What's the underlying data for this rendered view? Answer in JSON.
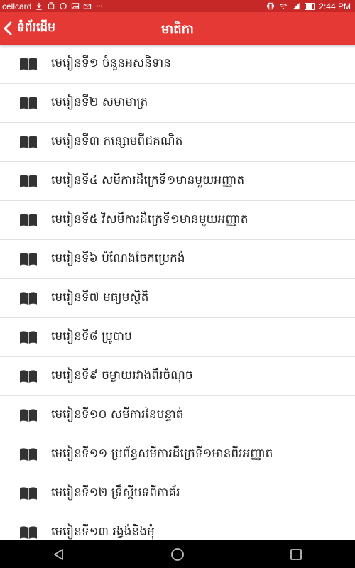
{
  "status_bar": {
    "carrier": "cellcard",
    "time": "2:44 PM"
  },
  "app_bar": {
    "back_label": "ទំព័រដើម",
    "title": "មាតិកា"
  },
  "lessons": [
    "មេរៀនទី១ ចំនួនអសនិទាន",
    "មេរៀនទី២ សមាមាត្រ",
    "មេរៀនទី៣ កន្សោមពីជគណិត",
    "មេរៀនទី៤ សមីការដឺក្រេទី១មានមួយអញ្ញាត",
    "មេរៀនទី៥ វិសមីការដឺក្រេទី១មានមួយអញ្ញាត",
    "មេរៀនទី៦ បំណែងចែកប្រេកង់",
    "មេរៀនទី៧ មធ្យមស្ថិតិ",
    "មេរៀនទី៨ ប្រូបាប",
    "មេរៀនទី៩ ចម្ងាយរវាងពីរចំណុច",
    "មេរៀនទី១០ សមីការនៃបន្ទាត់",
    "មេរៀនទី១១ ប្រព័ន្ធសមីការដឺក្រេទី១មានពីរអញ្ញាត",
    "មេរៀនទី១២ ទ្រឹស្តីបទពីតាគ័រ",
    "មេរៀនទី១៣ រង្វង់និងមុំ"
  ],
  "icons": {
    "list_item": "book-icon",
    "back": "chevron-left-icon",
    "nav": [
      "back-triangle-icon",
      "home-circle-icon",
      "recents-square-icon"
    ]
  },
  "colors": {
    "app_bar": "#e53935",
    "status_bar": "#c62828",
    "icon": "#333333",
    "text": "#222222"
  }
}
